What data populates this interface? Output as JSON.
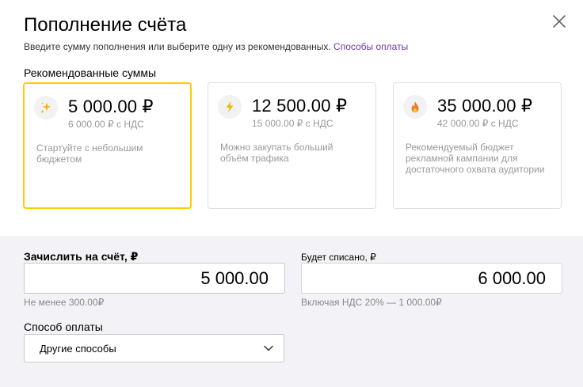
{
  "dialog": {
    "title": "Пополнение счёта",
    "subtitle": "Введите сумму пополнения или выберите одну из рекомендованных.",
    "payment_methods_link": "Способы оплаты"
  },
  "recommended": {
    "title": "Рекомендованные суммы",
    "cards": [
      {
        "icon": "sparkles-icon",
        "amount": "5 000.00 ₽",
        "vat": "6 000.00 ₽ с НДС",
        "description": "Стартуйте с небольшим бюджетом",
        "selected": true
      },
      {
        "icon": "lightning-icon",
        "amount": "12 500.00 ₽",
        "vat": "15 000.00 ₽ с НДС",
        "description": "Можно закупать больший объём трафика",
        "selected": false
      },
      {
        "icon": "fire-icon",
        "amount": "35 000.00 ₽",
        "vat": "42 000.00 ₽ с НДС",
        "description": "Рекомендуемый бюджет рекламной кампании для достаточного охвата аудитории",
        "selected": false
      }
    ]
  },
  "form": {
    "credit_label": "Зачислить на счёт, ₽",
    "credit_value": "5 000.00",
    "credit_hint": "Не менее 300.00₽",
    "debit_label": "Будет списано, ₽",
    "debit_value": "6 000.00",
    "debit_hint": "Включая НДС 20% — 1 000.00₽",
    "payment_label": "Способ оплаты",
    "payment_value": "Другие способы"
  },
  "colors": {
    "accent_selected": "#ffcc00",
    "link": "#6e3aa8",
    "icon_yellow": "#f5b800",
    "icon_orange": "#f07b24",
    "panel_bg": "#f3f2f6"
  }
}
